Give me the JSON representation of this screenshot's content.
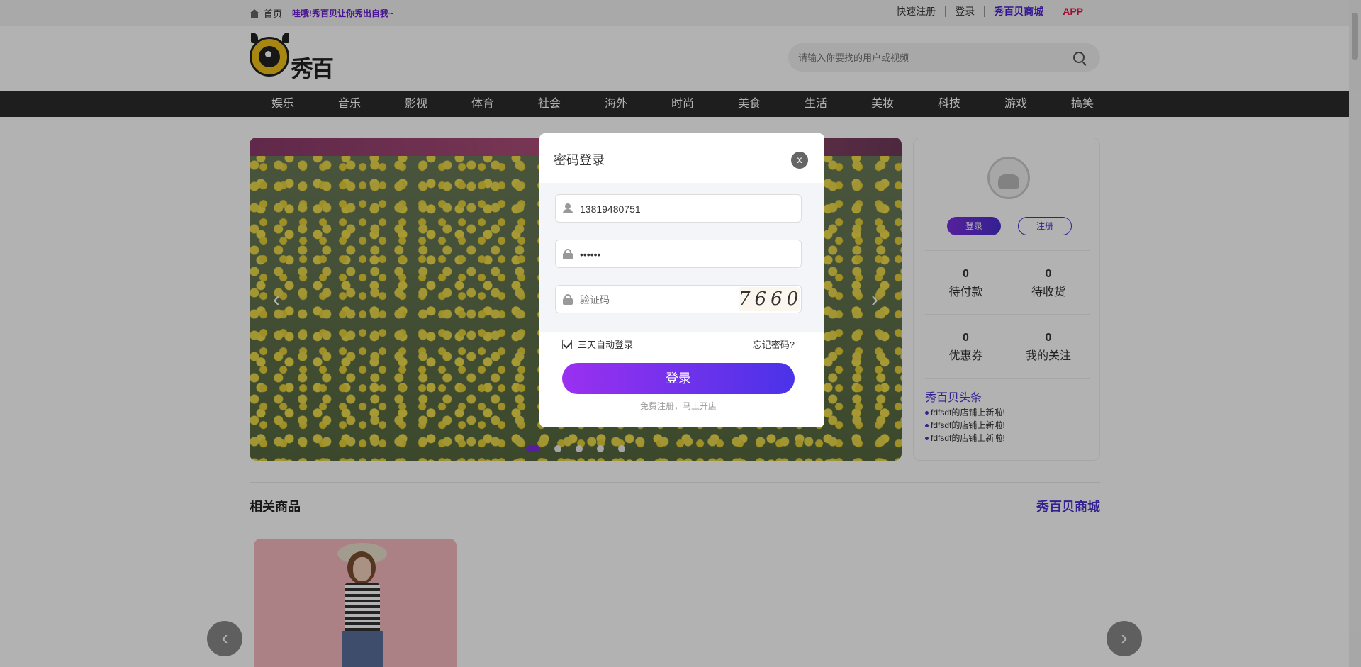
{
  "topbar": {
    "home": "首页",
    "slogan": "哇哦!秀百贝让你秀出自我~",
    "links": [
      "快速注册",
      "登录",
      "秀百贝商城",
      "APP"
    ]
  },
  "header": {
    "logo_text": "秀百贝",
    "search_placeholder": "请输入你要找的用户或视频"
  },
  "nav": [
    "娱乐",
    "音乐",
    "影视",
    "体育",
    "社会",
    "海外",
    "时尚",
    "美食",
    "生活",
    "美妆",
    "科技",
    "游戏",
    "搞笑"
  ],
  "banner": {
    "slide_count": 5,
    "active_slide": 1
  },
  "user_panel": {
    "login": "登录",
    "register": "注册",
    "stats": [
      {
        "num": "0",
        "label": "待付款"
      },
      {
        "num": "0",
        "label": "待收货"
      },
      {
        "num": "0",
        "label": "优惠券"
      },
      {
        "num": "0",
        "label": "我的关注"
      }
    ],
    "headline_title": "秀百贝头条",
    "news": [
      "fdfsdf的店铺上新啦!",
      "fdfsdf的店铺上新啦!",
      "fdfsdf的店铺上新啦!"
    ]
  },
  "products": {
    "title": "相关商品",
    "more": "秀百贝商城"
  },
  "modal": {
    "title": "密码登录",
    "close": "x",
    "phone_value": "13819480751",
    "password_value": "••••••",
    "captcha_placeholder": "验证码",
    "captcha_text": "7660",
    "remember_label": "三天自动登录",
    "remember_checked": true,
    "forgot": "忘记密码?",
    "login_button": "登录",
    "register_hint": "免费注册，马上开店"
  },
  "colors": {
    "accent": "#4a2fd0",
    "app": "#e4144c",
    "nav_bg": "#2b2b2b"
  }
}
